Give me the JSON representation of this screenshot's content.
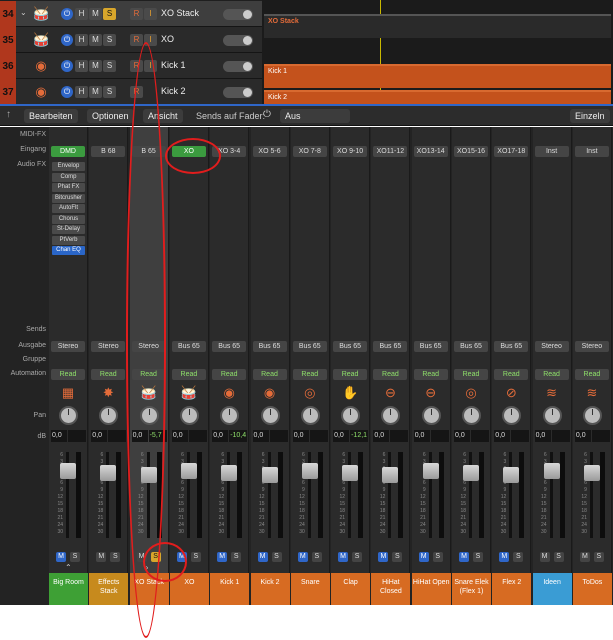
{
  "tracks": [
    {
      "num": "34",
      "name": "XO Stack",
      "selected": true,
      "rec": "R",
      "input": "I",
      "solo_on": true,
      "icon": "drum-kit-icon"
    },
    {
      "num": "35",
      "name": "XO",
      "selected": false,
      "rec": "R",
      "input": "I",
      "solo_on": false,
      "icon": "drum-kit-icon"
    },
    {
      "num": "36",
      "name": "Kick 1",
      "selected": false,
      "rec": "R",
      "input": "I",
      "solo_on": false,
      "icon": "kick-drum-icon"
    },
    {
      "num": "37",
      "name": "Kick 2",
      "selected": false,
      "rec": "R",
      "input": "",
      "solo_on": false,
      "icon": "kick-drum-icon"
    }
  ],
  "track_buttons": {
    "h": "H",
    "m": "M",
    "s": "S"
  },
  "regions": {
    "stack": "XO Stack",
    "kick1": "Kick 1",
    "kick2": "Kick 2"
  },
  "toolbar": {
    "edit": "Bearbeiten",
    "options": "Optionen",
    "view": "Ansicht",
    "sends_on_fader_label": "Sends auf Fader:",
    "sends_on_fader_value": "Aus",
    "single": "Einzeln"
  },
  "row_labels": {
    "midi_fx": "MIDI-FX",
    "input": "Eingang",
    "audio_fx": "Audio FX",
    "sends": "Sends",
    "output": "Ausgabe",
    "group": "Gruppe",
    "automation": "Automation",
    "pan": "Pan",
    "db": "dB"
  },
  "fx_chain": [
    "Envelop",
    "Comp",
    "Phat FX",
    "Bitcrusher",
    "AutoFlt",
    "Chorus",
    "St-Delay",
    "PtVerb",
    "Chan EQ"
  ],
  "strips": [
    {
      "name": "Big Room",
      "input": "DMD",
      "input_green": true,
      "output": "Stereo",
      "automation": "Read",
      "vol": "0,0",
      "peak": "",
      "color": "green",
      "icon": "keyboard-icon",
      "m_on": true
    },
    {
      "name": "Effects Stack",
      "input": "B 68",
      "input_green": false,
      "output": "Stereo",
      "automation": "Read",
      "vol": "0,0",
      "peak": "",
      "color": "gold",
      "icon": "burst-icon",
      "m_on": false
    },
    {
      "name": "XO Stack",
      "input": "B 65",
      "input_green": false,
      "output": "Stereo",
      "automation": "Read",
      "vol": "0,0",
      "peak": "-5,7",
      "color": "orange",
      "icon": "drum-kit-icon",
      "m_on": false,
      "selected": true,
      "solo_on": true
    },
    {
      "name": "XO",
      "input": "XO",
      "input_green": true,
      "output": "Bus 65",
      "automation": "Read",
      "vol": "0,0",
      "peak": "",
      "color": "orange",
      "icon": "drum-kit-icon",
      "m_on": true
    },
    {
      "name": "Kick 1",
      "input": "XO 3-4",
      "input_green": false,
      "output": "Bus 65",
      "automation": "Read",
      "vol": "0,0",
      "peak": "-10,4",
      "color": "orange",
      "icon": "kick-drum-icon",
      "m_on": true
    },
    {
      "name": "Kick 2",
      "input": "XO 5-6",
      "input_green": false,
      "output": "Bus 65",
      "automation": "Read",
      "vol": "0,0",
      "peak": "",
      "color": "orange",
      "icon": "kick-drum-icon",
      "m_on": true
    },
    {
      "name": "Snare",
      "input": "XO 7-8",
      "input_green": false,
      "output": "Bus 65",
      "automation": "Read",
      "vol": "0,0",
      "peak": "",
      "color": "orange",
      "icon": "snare-drum-icon",
      "m_on": true
    },
    {
      "name": "Clap",
      "input": "XO 9-10",
      "input_green": false,
      "output": "Bus 65",
      "automation": "Read",
      "vol": "0,0",
      "peak": "-12,1",
      "color": "orange",
      "icon": "hand-clap-icon",
      "m_on": true
    },
    {
      "name": "HiHat Closed",
      "input": "XO11-12",
      "input_green": false,
      "output": "Bus 65",
      "automation": "Read",
      "vol": "0,0",
      "peak": "",
      "color": "orange",
      "icon": "hihat-icon",
      "m_on": true
    },
    {
      "name": "HiHat Open",
      "input": "XO13-14",
      "input_green": false,
      "output": "Bus 65",
      "automation": "Read",
      "vol": "0,0",
      "peak": "",
      "color": "orange",
      "icon": "hihat-icon",
      "m_on": true
    },
    {
      "name": "Snare Elek (Flex 1)",
      "input": "XO15-16",
      "input_green": false,
      "output": "Bus 65",
      "automation": "Read",
      "vol": "0,0",
      "peak": "",
      "color": "orange",
      "icon": "snare-drum-icon",
      "m_on": true
    },
    {
      "name": "Flex 2",
      "input": "XO17-18",
      "input_green": false,
      "output": "Bus 65",
      "automation": "Read",
      "vol": "0,0",
      "peak": "",
      "color": "orange",
      "icon": "cymbal-icon",
      "m_on": true
    },
    {
      "name": "Ideen",
      "input": "Inst",
      "input_green": false,
      "output": "Stereo",
      "automation": "Read",
      "vol": "0,0",
      "peak": "",
      "color": "blue",
      "icon": "waveform-icon",
      "m_on": false
    },
    {
      "name": "ToDos",
      "input": "Inst",
      "input_green": false,
      "output": "Stereo",
      "automation": "Read",
      "vol": "0,0",
      "peak": "",
      "color": "orange",
      "icon": "waveform-icon",
      "m_on": false
    }
  ],
  "strip_buttons": {
    "m": "M",
    "s": "S"
  },
  "colors": {
    "accent_orange": "#c4521c",
    "annotation_red": "#e11d1d",
    "input_green": "#3b9b3f"
  }
}
